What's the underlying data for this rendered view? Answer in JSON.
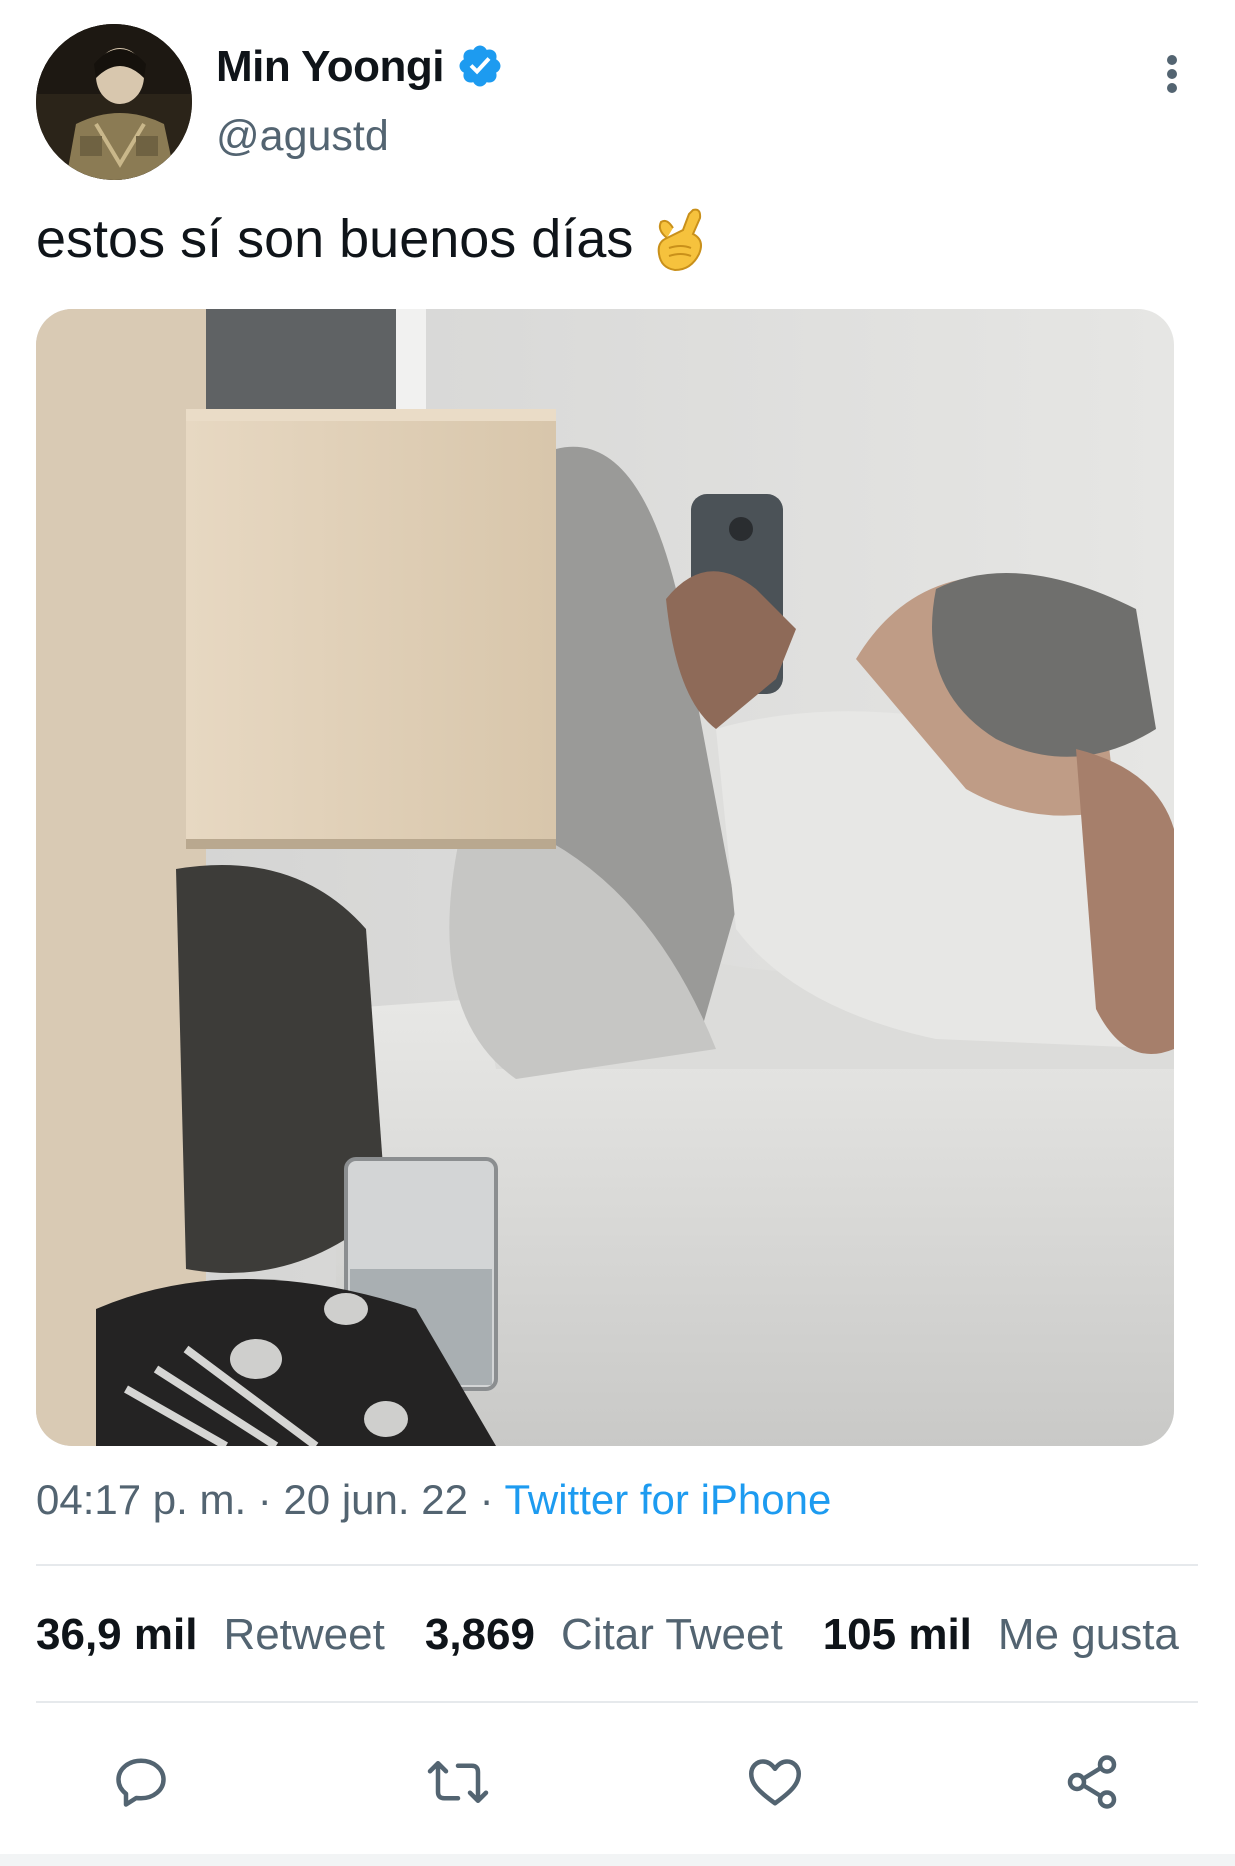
{
  "user": {
    "display_name": "Min Yoongi",
    "handle": "@agustd",
    "verified": true,
    "avatar_icon": "avatar-photo"
  },
  "tweet": {
    "text": "estos sí son buenos días",
    "emoji": "call-me-hand-emoji"
  },
  "media": {
    "type": "photo"
  },
  "meta": {
    "time": "04:17 p. m.",
    "separator": "·",
    "date": "20 jun. 22",
    "source": "Twitter for iPhone"
  },
  "stats": {
    "retweets_count": "36,9 mil",
    "retweets_label": "Retweet",
    "quotes_count": "3,869",
    "quotes_label": "Citar Tweet",
    "likes_count": "105 mil",
    "likes_label": "Me gusta"
  },
  "actions": [
    "reply-icon",
    "retweet-icon",
    "like-icon",
    "share-icon"
  ],
  "colors": {
    "accent": "#1d9bf0",
    "secondary_text": "#536471",
    "primary_text": "#0f1419",
    "divider": "#e6e9ec"
  }
}
